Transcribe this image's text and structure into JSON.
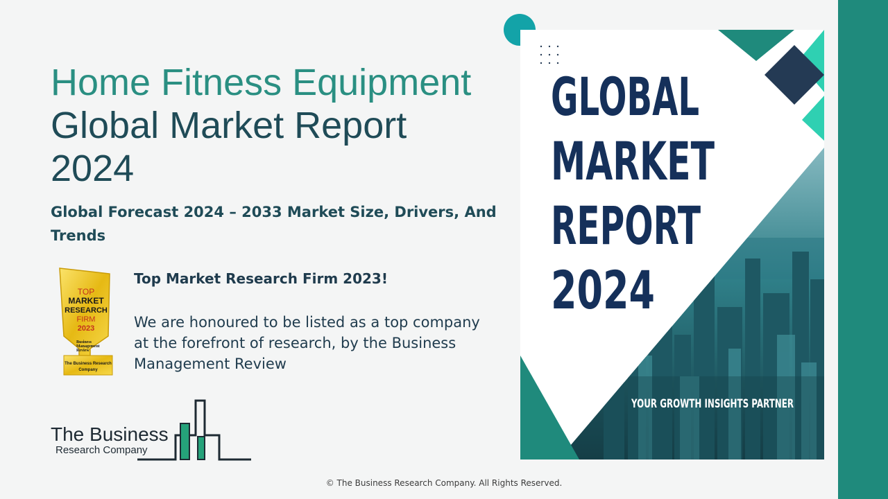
{
  "title": {
    "accent": "Home Fitness Equipment",
    "rest": " Global Market Report 2024"
  },
  "subtitle": "Global Forecast 2024 – 2033 Market Size, Drivers, And Trends",
  "award": {
    "badge_lines": [
      "TOP",
      "MARKET",
      "RESEARCH",
      "FIRM",
      "2023"
    ],
    "badge_footer": [
      "The Business Research",
      "Company"
    ],
    "badge_publisher": [
      "Business",
      "Management",
      "Review"
    ],
    "heading": "Top Market Research Firm 2023!",
    "body": "We are honoured to be listed as a top company at the forefront of research, by the Business Management Review"
  },
  "logo": {
    "line1": "The Business",
    "line2": "Research Company"
  },
  "cover": {
    "lines": [
      "GLOBAL",
      "MARKET",
      "REPORT",
      "2024"
    ],
    "tagline": "YOUR GROWTH INSIGHTS PARTNER"
  },
  "footer": "© The Business  Research Company.  All Rights Reserved.",
  "colors": {
    "teal": "#1f8a7c",
    "accent_text": "#2a8f82",
    "navy": "#1a2f4e",
    "gold": "#e8c31a"
  }
}
